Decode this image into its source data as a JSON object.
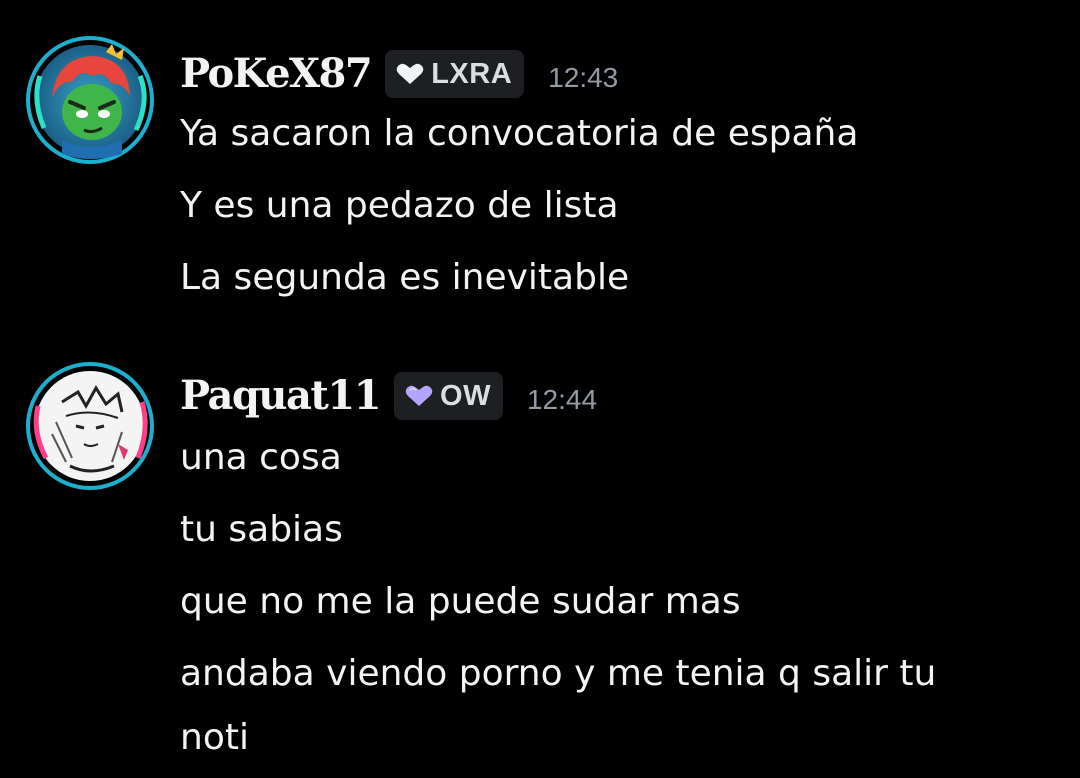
{
  "messages": [
    {
      "username": "PoKeX87",
      "tag": "LXRA",
      "tag_color": "#f2f3f5",
      "avatar_icon": "green-character-avatar-icon",
      "timestamp": "12:43",
      "lines": [
        "Ya sacaron la convocatoria de españa",
        "Y es una pedazo de lista",
        "La segunda es inevitable"
      ]
    },
    {
      "username": "Paquat11",
      "tag": "OW",
      "tag_color": "#b4a3ff",
      "avatar_icon": "manga-character-avatar-icon",
      "timestamp": "12:44",
      "lines": [
        "una cosa",
        "tu sabias",
        "que no me la puede sudar mas",
        "andaba viendo porno y me tenia q salir tu",
        "noti"
      ]
    }
  ],
  "colors": {
    "background": "#000000",
    "text": "#f2f3f5",
    "timestamp": "#949ba4",
    "tag_background": "#1e1f22",
    "avatar_ring_1": "#1fc3e6",
    "avatar_ring_2": "#2de0c8"
  }
}
